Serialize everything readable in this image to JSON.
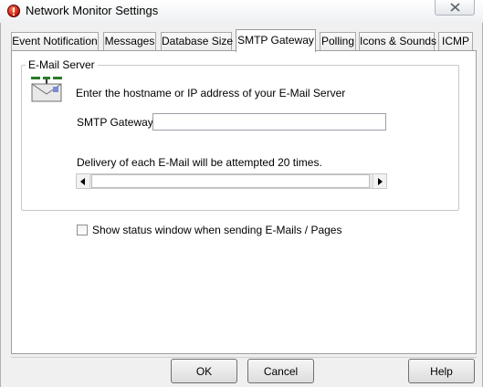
{
  "window": {
    "title": "Network Monitor Settings",
    "icon": "app-alert-icon",
    "close_icon": "close-icon"
  },
  "tabs": [
    {
      "label": "Event Notification"
    },
    {
      "label": "Messages"
    },
    {
      "label": "Database Size"
    },
    {
      "label": "SMTP Gateway",
      "active": true
    },
    {
      "label": "Polling"
    },
    {
      "label": "Icons & Sounds"
    },
    {
      "label": "ICMP"
    }
  ],
  "email_server": {
    "group_label": "E-Mail Server",
    "icon": "mail-server-icon",
    "instructions": "Enter the hostname or IP address of your E-Mail Server",
    "gateway_label": "SMTP Gateway",
    "gateway_value": "",
    "delivery_text": "Delivery of each E-Mail will be attempted 20 times.",
    "delivery_attempts": 20
  },
  "options": {
    "show_status_label": "Show status window when sending E-Mails / Pages",
    "show_status_checked": false
  },
  "buttons": {
    "ok": "OK",
    "cancel": "Cancel",
    "help": "Help"
  },
  "colors": {
    "dialog_bg": "#f0f0f0",
    "panel_bg": "#ffffff",
    "icon_red": "#c3130a"
  }
}
